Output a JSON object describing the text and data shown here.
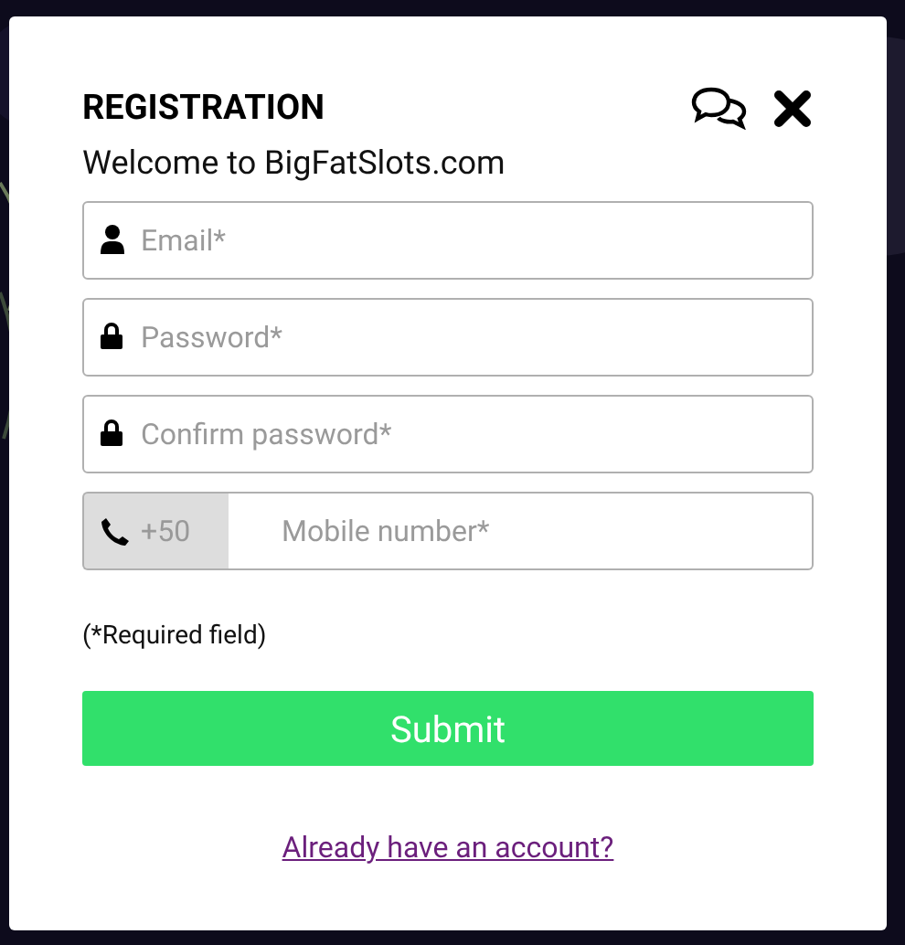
{
  "dialog": {
    "title": "REGISTRATION",
    "subtitle": "Welcome to BigFatSlots.com"
  },
  "fields": [
    {
      "kind": "email",
      "placeholder": "Email*"
    },
    {
      "kind": "password",
      "placeholder": "Password*"
    },
    {
      "kind": "password",
      "placeholder": "Confirm password*"
    },
    {
      "kind": "phone",
      "prefix": "+50",
      "placeholder": "Mobile number*"
    }
  ],
  "note": "(*Required field)",
  "submit": "Submit",
  "login_link": "Already have an account?"
}
